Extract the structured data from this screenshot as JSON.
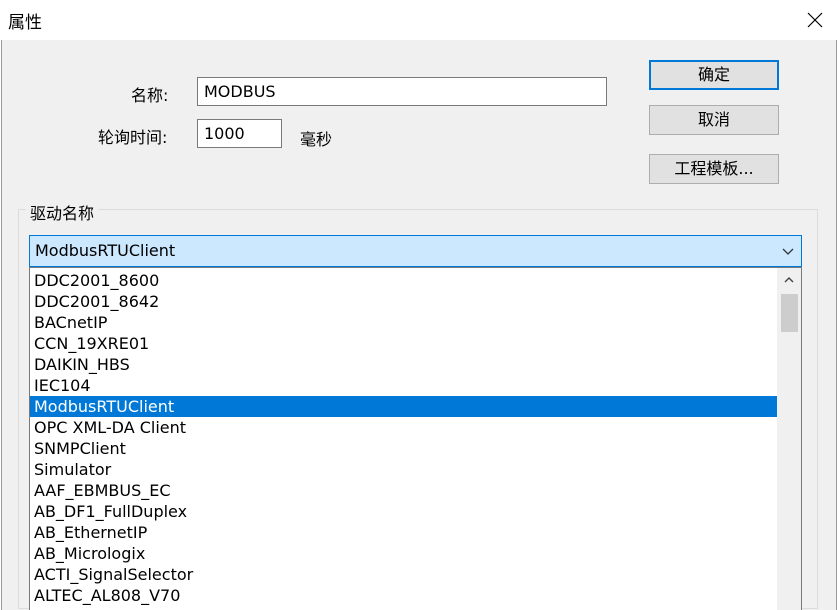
{
  "window": {
    "title": "属性",
    "close_icon": "close-icon"
  },
  "form": {
    "name_label": "名称:",
    "name_value": "MODBUS",
    "poll_label": "轮询时间:",
    "poll_value": "1000",
    "poll_unit": "毫秒"
  },
  "buttons": {
    "ok": "确定",
    "cancel": "取消",
    "template": "工程模板..."
  },
  "driver": {
    "group_label": "驱动名称",
    "selected": "ModbusRTUClient",
    "items": [
      "DDC2001_8600",
      "DDC2001_8642",
      "BACnetIP",
      "CCN_19XRE01",
      "DAIKIN_HBS",
      "IEC104",
      "ModbusRTUClient",
      "OPC XML-DA Client",
      "SNMPClient",
      "Simulator",
      "AAF_EBMBUS_EC",
      "AB_DF1_FullDuplex",
      "AB_EthernetIP",
      "AB_Micrologix",
      "ACTI_SignalSelector",
      "ALTEC_AL808_V70"
    ],
    "selected_index": 6
  },
  "colors": {
    "accent": "#0078d7",
    "selection": "#0078d7",
    "combo_bg": "#cce8ff"
  }
}
